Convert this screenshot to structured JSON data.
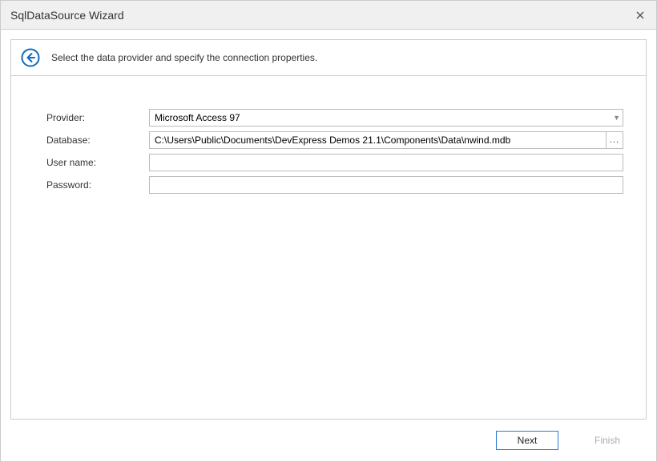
{
  "window": {
    "title": "SqlDataSource Wizard"
  },
  "header": {
    "instruction": "Select the data provider and specify the connection properties."
  },
  "form": {
    "provider": {
      "label": "Provider:",
      "value": "Microsoft Access 97"
    },
    "database": {
      "label": "Database:",
      "value": "C:\\Users\\Public\\Documents\\DevExpress Demos 21.1\\Components\\Data\\nwind.mdb",
      "browse": "..."
    },
    "username": {
      "label": "User name:",
      "value": ""
    },
    "password": {
      "label": "Password:",
      "value": ""
    }
  },
  "buttons": {
    "next": "Next",
    "finish": "Finish"
  }
}
